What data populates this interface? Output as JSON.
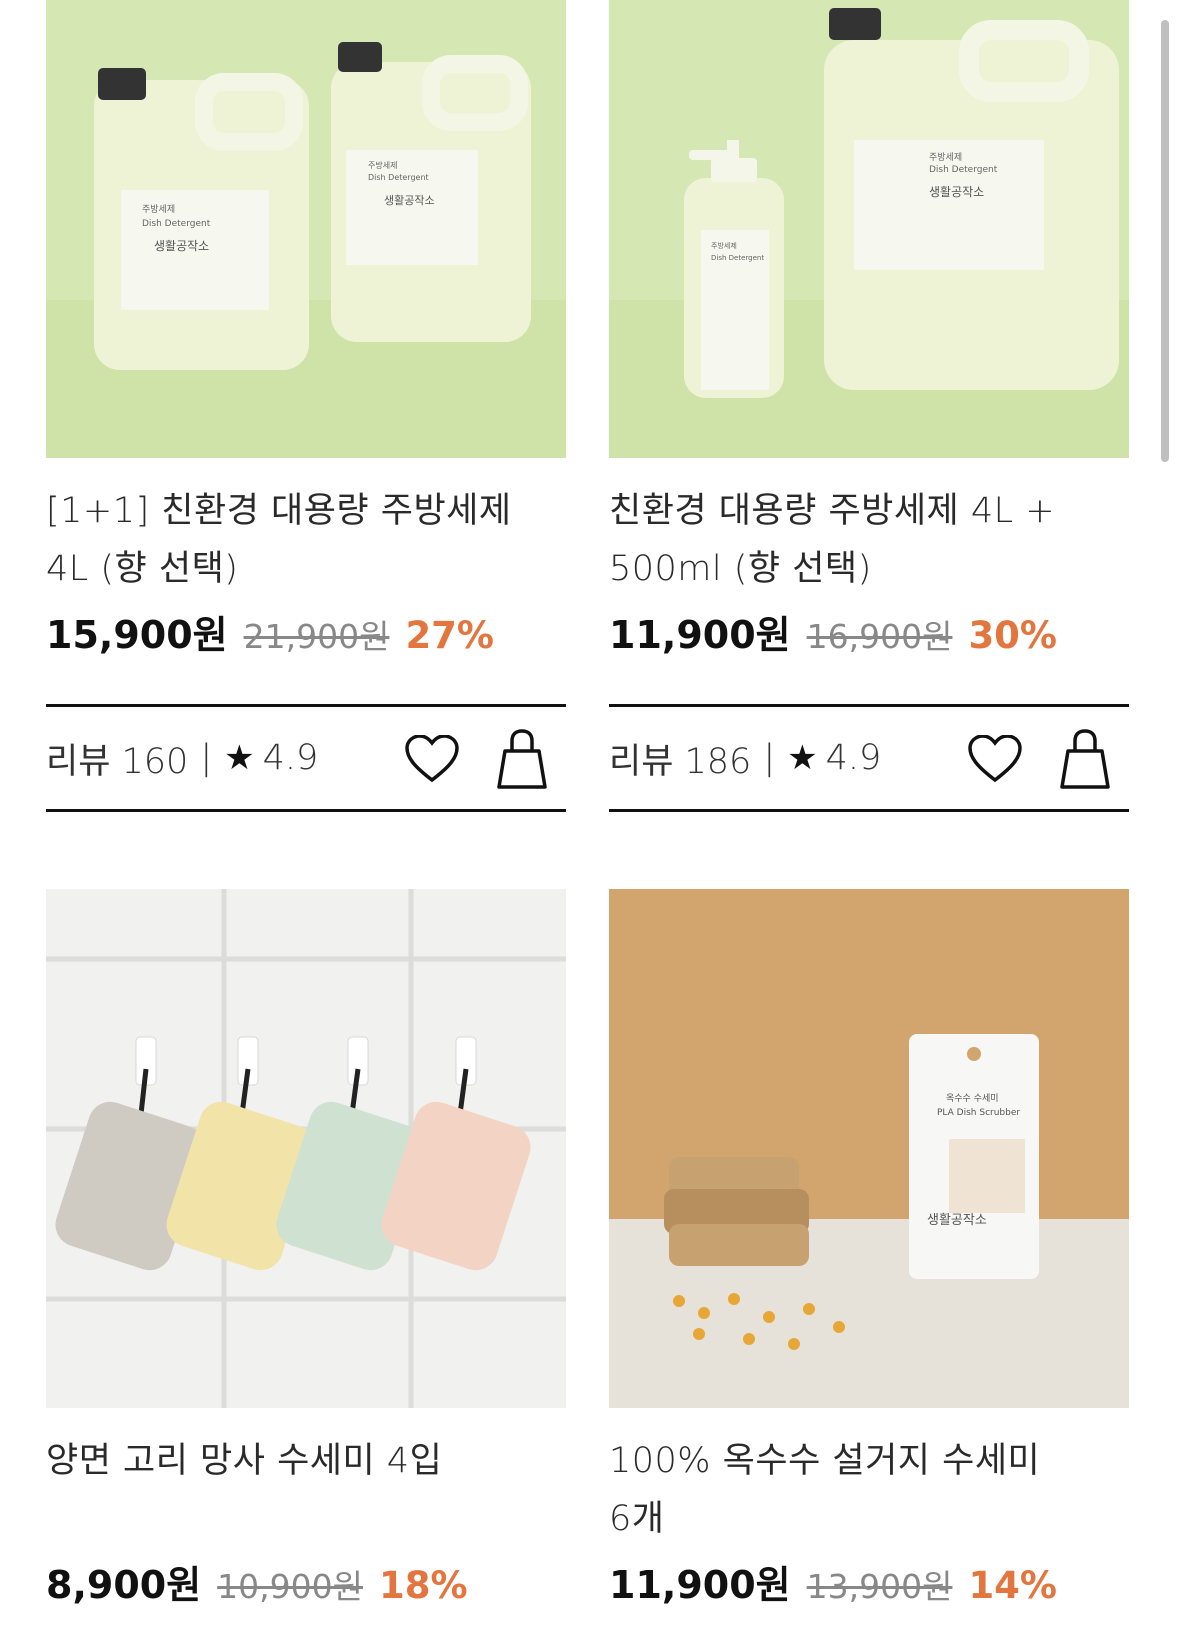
{
  "products": [
    {
      "title_line1": "[1+1] 친환경 대용량 주방세제",
      "title_line2": "4L (향 선택)",
      "price": "15,900원",
      "original_price": "21,900원",
      "discount": "27%",
      "review_label": "리뷰 160",
      "rating": "4.9",
      "image_text": {
        "ko": "주방세제",
        "en": "Dish Detergent",
        "brand": "생활공작소"
      }
    },
    {
      "title_line1": "친환경 대용량 주방세제 4L +",
      "title_line2": "500ml (향 선택)",
      "price": "11,900원",
      "original_price": "16,900원",
      "discount": "30%",
      "review_label": "리뷰 186",
      "rating": "4.9",
      "image_text": {
        "ko": "주방세제",
        "en": "Dish Detergent",
        "brand": "생활공작소"
      }
    },
    {
      "title_line1": "양면 고리 망사 수세미 4입",
      "title_line2": "",
      "price": "8,900원",
      "original_price": "10,900원",
      "discount": "18%"
    },
    {
      "title_line1": "100% 옥수수 설거지 수세미",
      "title_line2": "6개",
      "price": "11,900원",
      "original_price": "13,900원",
      "discount": "14%",
      "image_text": {
        "ko": "옥수수 수세미",
        "en": "PLA Dish Scrubber",
        "brand": "생활공작소"
      }
    }
  ],
  "separator": "|",
  "icons": {
    "wishlist": "heart-icon",
    "cart": "shopping-bag-icon",
    "rating": "star-icon"
  },
  "colors": {
    "discount": "#e3753e",
    "detergent_bg": "#d5e8b3",
    "corn_bg": "#d3a56e"
  }
}
